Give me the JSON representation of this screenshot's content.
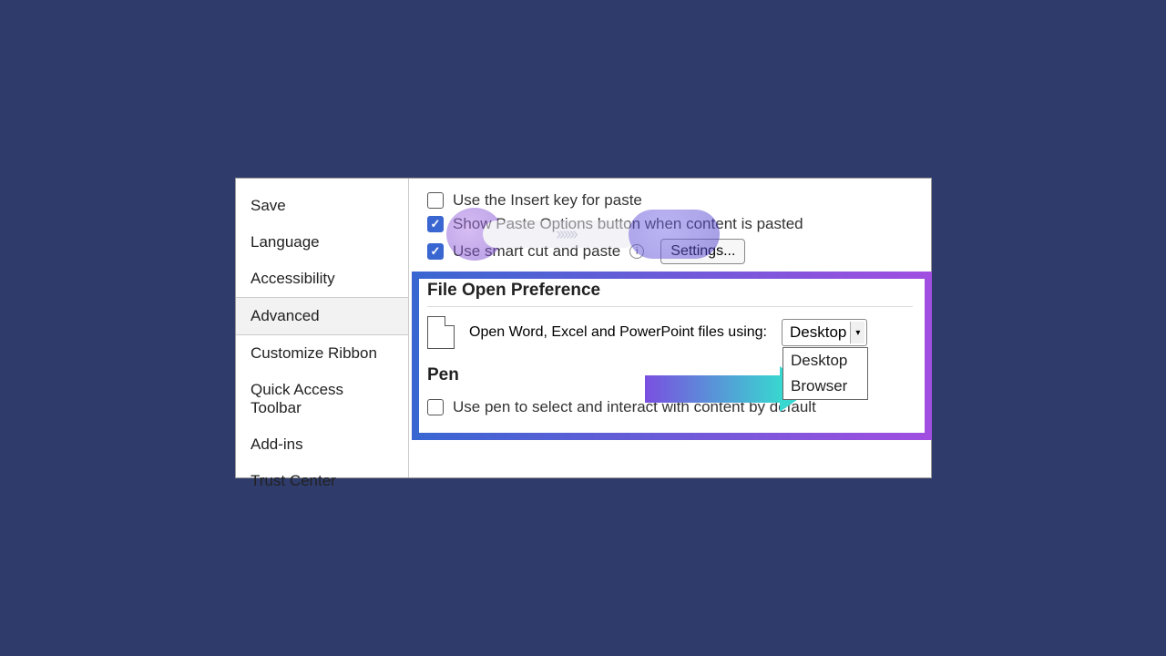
{
  "sidebar": {
    "items": [
      {
        "label": "Save"
      },
      {
        "label": "Language"
      },
      {
        "label": "Accessibility"
      },
      {
        "label": "Advanced",
        "selected": true
      },
      {
        "label": "Customize Ribbon"
      },
      {
        "label": "Quick Access Toolbar"
      },
      {
        "label": "Add-ins"
      },
      {
        "label": "Trust Center"
      }
    ]
  },
  "content": {
    "insert_key_label": "Use the Insert key for paste",
    "paste_options_label": "Show Paste Options button when content is pasted",
    "smart_cut_paste_label": "Use smart cut and paste",
    "settings_button": "Settings...",
    "file_open_title": "File Open Preference",
    "open_files_label": "Open Word, Excel and PowerPoint files using:",
    "dropdown_selected": "Desktop",
    "dropdown_options": [
      "Desktop",
      "Browser"
    ],
    "pen_title": "Pen",
    "pen_checkbox_label": "Use pen to select and interact with content by default"
  }
}
